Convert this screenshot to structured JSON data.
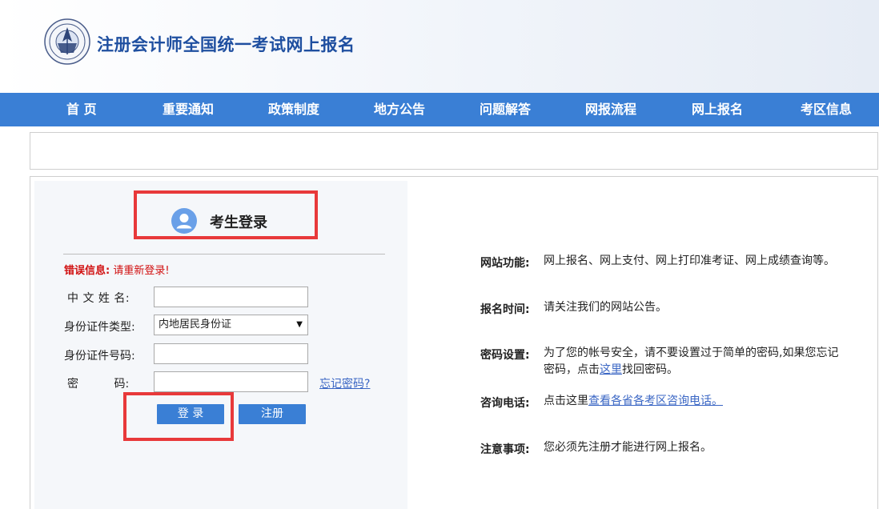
{
  "header": {
    "site_title": "注册会计师全国统一考试网上报名"
  },
  "nav": {
    "items": [
      "首 页",
      "重要通知",
      "政策制度",
      "地方公告",
      "问题解答",
      "网报流程",
      "网上报名",
      "考区信息"
    ]
  },
  "login": {
    "title": "考生登录",
    "error_label": "错误信息:",
    "error_text": "请重新登录!",
    "fields": {
      "name_label": "中 文 姓 名:",
      "name_value": "",
      "id_type_label": "身份证件类型:",
      "id_type_selected": "内地居民身份证",
      "id_number_label": "身份证件号码:",
      "id_number_value": "",
      "password_label": "密          码:",
      "password_value": ""
    },
    "forgot_password": "忘记密码?",
    "login_button": "登 录",
    "register_button": "注册"
  },
  "info": {
    "functions_label": "网站功能:",
    "functions_text": "网上报名、网上支付、网上打印准考证、网上成绩查询等。",
    "time_label": "报名时间:",
    "time_text": "请关注我们的网站公告。",
    "password_label": "密码设置:",
    "password_text_1": "为了您的帐号安全，请不要设置过于简单的密码,如果您忘记密码，点击",
    "password_link": "这里",
    "password_text_2": "找回密码。",
    "contact_label": "咨询电话:",
    "contact_text": "点击这里",
    "contact_link": "查看各省各考区咨询电话。",
    "notice_label": "注意事项:",
    "notice_text": "您必须先注册才能进行网上报名。"
  },
  "colors": {
    "nav_bg": "#3a7fd5",
    "title_blue": "#1f4fa0",
    "highlight_red": "#e8393a",
    "error_red": "#d11010",
    "link_blue": "#3a66c4"
  }
}
